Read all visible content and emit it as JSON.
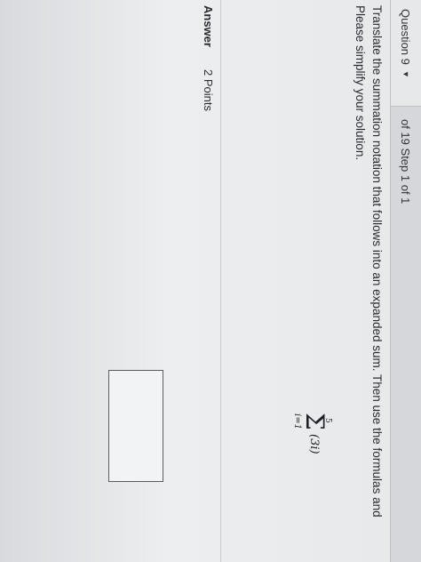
{
  "header": {
    "question_label": "Question 9",
    "dropdown_caret": "chevron-down-icon",
    "progress": "of 19 Step 1 of 1"
  },
  "prompt": {
    "line1": "Translate the summation notation that follows into an expanded sum. Then use the formulas and",
    "line2": "Please simplify your solution."
  },
  "formula": {
    "upper_limit": "5",
    "sigma": "Σ",
    "lower_limit": "i=1",
    "summand": "(3i)"
  },
  "answer": {
    "label": "Answer",
    "points": "2 Points",
    "input_value": ""
  }
}
